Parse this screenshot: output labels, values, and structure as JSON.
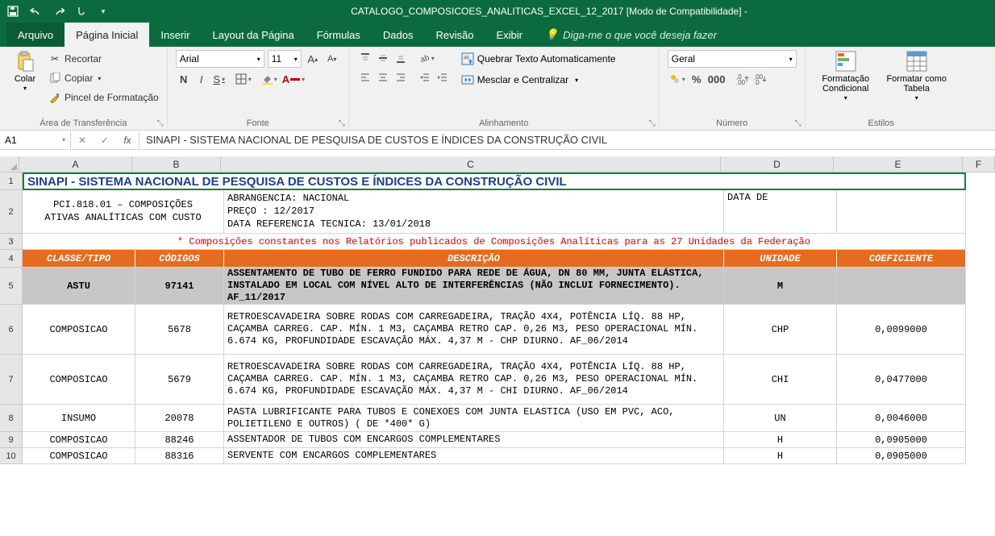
{
  "titlebar": {
    "title": "CATALOGO_COMPOSICOES_ANALITICAS_EXCEL_12_2017  [Modo de Compatibilidade]  -"
  },
  "tabs": {
    "file": "Arquivo",
    "items": [
      "Página Inicial",
      "Inserir",
      "Layout da Página",
      "Fórmulas",
      "Dados",
      "Revisão",
      "Exibir"
    ],
    "tellme": "Diga-me o que você deseja fazer"
  },
  "ribbon": {
    "clipboard": {
      "paste": "Colar",
      "cut": "Recortar",
      "copy": "Copiar",
      "painter": "Pincel de Formatação",
      "title": "Área de Transferência"
    },
    "font": {
      "name": "Arial",
      "size": "11",
      "title": "Fonte"
    },
    "align": {
      "wrap": "Quebrar Texto Automaticamente",
      "merge": "Mesclar e Centralizar",
      "title": "Alinhamento"
    },
    "number": {
      "format": "Geral",
      "title": "Número"
    },
    "styles": {
      "cond": "Formatação\nCondicional",
      "table": "Formatar como\nTabela",
      "title": "Estilos"
    }
  },
  "fx": {
    "name": "A1",
    "formula": "SINAPI - SISTEMA NACIONAL DE PESQUISA DE CUSTOS E ÍNDICES DA CONSTRUÇÃO CIVIL"
  },
  "cols": [
    "A",
    "B",
    "C",
    "D",
    "E",
    "F"
  ],
  "r1": {
    "text": "SINAPI - SISTEMA NACIONAL DE PESQUISA DE CUSTOS E ÍNDICES DA CONSTRUÇÃO CIVIL"
  },
  "r2": {
    "left": "PCI.818.01 – COMPOSIÇÕES\nATIVAS ANALÍTICAS COM CUSTO",
    "mid": "ABRANGENCIA: NACIONAL\nPREÇO           :   12/2017\nDATA REFERENCIA TECNICA: 13/01/2018",
    "d": "DATA DE"
  },
  "r3": {
    "note": "* Composições constantes nos Relatórios publicados de Composições Analíticas para as 27 Unidades da Federação"
  },
  "headers": {
    "a": "CLASSE/TIPO",
    "b": "CÓDIGOS",
    "c": "DESCRIÇÃO",
    "d": "UNIDADE",
    "e": "COEFICIENTE"
  },
  "r5": {
    "a": "ASTU",
    "b": "97141",
    "c": "ASSENTAMENTO DE TUBO DE FERRO FUNDIDO PARA REDE DE ÁGUA, DN 80 MM, JUNTA ELÁSTICA, INSTALADO EM LOCAL COM NÍVEL ALTO DE INTERFERÊNCIAS (NÃO INCLUI FORNECIMENTO). AF_11/2017",
    "d": "M",
    "e": ""
  },
  "rows": [
    {
      "rn": "6",
      "a": "COMPOSICAO",
      "b": "5678",
      "c": "RETROESCAVADEIRA SOBRE RODAS COM CARREGADEIRA, TRAÇÃO 4X4, POTÊNCIA LÍQ. 88 HP, CAÇAMBA CARREG. CAP. MÍN. 1 M3, CAÇAMBA RETRO CAP. 0,26 M3, PESO OPERACIONAL MÍN. 6.674 KG, PROFUNDIDADE ESCAVAÇÃO MÁX. 4,37 M - CHP DIURNO. AF_06/2014",
      "d": "CHP",
      "e": "0,0099000"
    },
    {
      "rn": "7",
      "a": "COMPOSICAO",
      "b": "5679",
      "c": "RETROESCAVADEIRA SOBRE RODAS COM CARREGADEIRA, TRAÇÃO 4X4, POTÊNCIA LÍQ. 88 HP, CAÇAMBA CARREG. CAP. MÍN. 1 M3, CAÇAMBA RETRO CAP. 0,26 M3, PESO OPERACIONAL MÍN. 6.674 KG, PROFUNDIDADE ESCAVAÇÃO MÁX. 4,37 M - CHI DIURNO. AF_06/2014",
      "d": "CHI",
      "e": "0,0477000"
    },
    {
      "rn": "8",
      "a": "INSUMO",
      "b": "20078",
      "c": "PASTA LUBRIFICANTE PARA TUBOS E CONEXOES COM JUNTA ELASTICA (USO EM PVC, ACO, POLIETILENO E OUTROS) ( DE *400* G)",
      "d": "UN",
      "e": "0,0046000"
    },
    {
      "rn": "9",
      "a": "COMPOSICAO",
      "b": "88246",
      "c": "ASSENTADOR DE TUBOS COM ENCARGOS COMPLEMENTARES",
      "d": "H",
      "e": "0,0905000"
    },
    {
      "rn": "10",
      "a": "COMPOSICAO",
      "b": "88316",
      "c": "SERVENTE COM ENCARGOS COMPLEMENTARES",
      "d": "H",
      "e": "0,0905000"
    }
  ]
}
